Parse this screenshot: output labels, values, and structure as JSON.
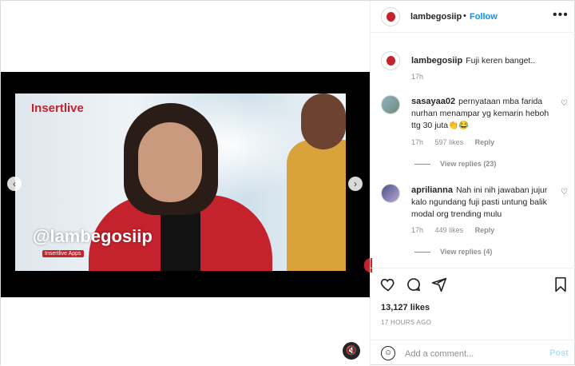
{
  "video": {
    "brand": "Insertlive",
    "brand_small": "",
    "watermark": "@lambegosiip",
    "sub_logo": "Insertlive Apps",
    "prev_icon": "‹",
    "next_icon": "›",
    "mute_icon": "🔇"
  },
  "header": {
    "username": "lambegosiip",
    "separator": "•",
    "follow_label": "Follow",
    "more_icon": "•••"
  },
  "caption": {
    "username": "lambegosiip",
    "text": "Fuji keren banget..",
    "time": "17h"
  },
  "comments": [
    {
      "username": "sasayaa02",
      "text": "pernyataan mba farida nurhan menampar yg kemarin heboh ttg 30 juta👏😂",
      "time": "17h",
      "likes": "597 likes",
      "reply_label": "Reply",
      "view_replies": "View replies (23)"
    },
    {
      "username": "aprilianna",
      "text": "Nah ini nih jawaban jujur kalo ngundang fuji pasti untung balik modal org trending mulu",
      "time": "17h",
      "likes": "449 likes",
      "reply_label": "Reply",
      "view_replies": "View replies (4)"
    }
  ],
  "actions": {
    "likes": "13,127 likes",
    "timestamp": "17 HOURS AGO"
  },
  "add_comment": {
    "placeholder": "Add a comment...",
    "post_label": "Post"
  },
  "colors": {
    "accent": "#0095f6",
    "post_disabled": "#b2dffc",
    "brand_red": "#c4222c"
  }
}
